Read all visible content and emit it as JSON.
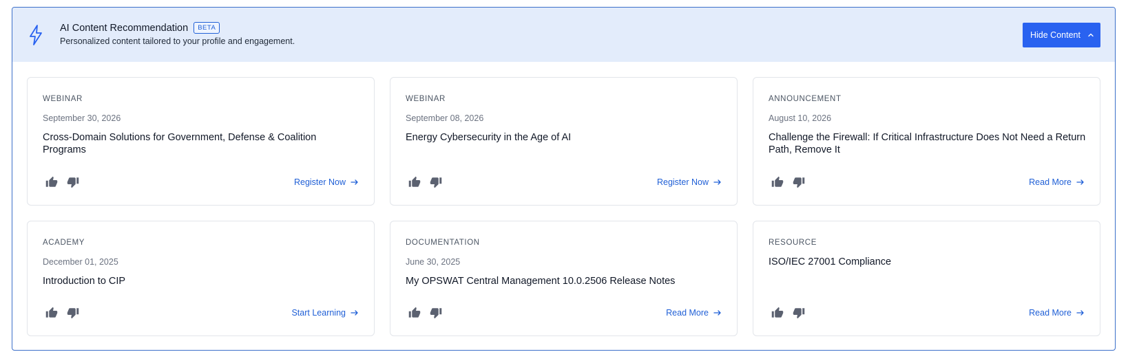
{
  "header": {
    "title": "AI Content Recommendation",
    "badge": "BETA",
    "subtitle": "Personalized content tailored to your profile and engagement.",
    "hide_button_label": "Hide Content",
    "icon": "lightning-bolt-icon",
    "accent_color": "#2962f0",
    "header_bg_color": "#e3ecfb"
  },
  "cards": [
    {
      "category": "WEBINAR",
      "date": "September 30, 2026",
      "title": "Cross-Domain Solutions for Government, Defense & Coalition Programs",
      "action": "Register Now"
    },
    {
      "category": "WEBINAR",
      "date": "September 08, 2026",
      "title": "Energy Cybersecurity in the Age of AI",
      "action": "Register Now"
    },
    {
      "category": "ANNOUNCEMENT",
      "date": "August 10, 2026",
      "title": "Challenge the Firewall: If Critical Infrastructure Does Not Need a Return Path, Remove It",
      "action": "Read More"
    },
    {
      "category": "ACADEMY",
      "date": "December 01, 2025",
      "title": "Introduction to CIP",
      "action": "Start Learning"
    },
    {
      "category": "DOCUMENTATION",
      "date": "June 30, 2025",
      "title": "My OPSWAT Central Management 10.0.2506 Release Notes",
      "action": "Read More"
    },
    {
      "category": "RESOURCE",
      "date": "",
      "title": "ISO/IEC 27001 Compliance",
      "action": "Read More"
    }
  ],
  "icons": {
    "like": "thumbs-up-icon",
    "dislike": "thumbs-down-icon",
    "action_arrow": "arrow-right-icon",
    "collapse": "chevron-up-icon"
  }
}
